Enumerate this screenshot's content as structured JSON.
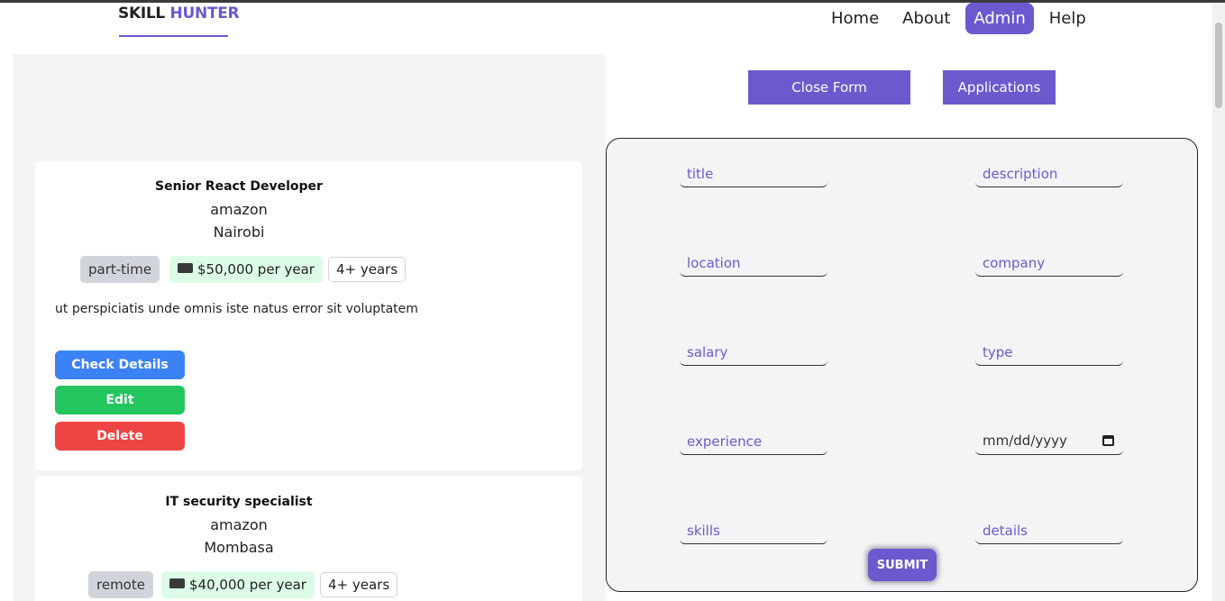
{
  "header": {
    "logo_part1": "SKILL",
    "logo_part2": "HUNTER",
    "nav": [
      "Home",
      "About",
      "Admin",
      "Help"
    ],
    "active_nav": "Admin"
  },
  "actions": {
    "close_form": "Close Form",
    "applications": "Applications"
  },
  "jobs": [
    {
      "title": "Senior React Developer",
      "company": "amazon",
      "location": "Nairobi",
      "type": "part-time",
      "salary": "$50,000 per year",
      "experience": "4+ years",
      "description": "ut perspiciatis unde omnis iste natus error sit voluptatem",
      "buttons": [
        "Check Details",
        "Edit",
        "Delete"
      ]
    },
    {
      "title": "IT security specialist",
      "company": "amazon",
      "location": "Mombasa",
      "type": "remote",
      "salary": "$40,000 per year",
      "experience": "4+ years"
    }
  ],
  "form": {
    "placeholders": {
      "title": "title",
      "description": "description",
      "location": "location",
      "company": "company",
      "salary": "salary",
      "type": "type",
      "experience": "experience",
      "date": "mm/dd/yyyy",
      "skills": "skills",
      "details": "details"
    },
    "submit_label": "SUBMIT"
  },
  "colors": {
    "brand": "#6a5acd",
    "check_details": "#3b82f6",
    "edit": "#22c55e",
    "delete": "#ef4444"
  },
  "icons": {
    "salary": "money-icon",
    "date": "calendar-icon"
  }
}
